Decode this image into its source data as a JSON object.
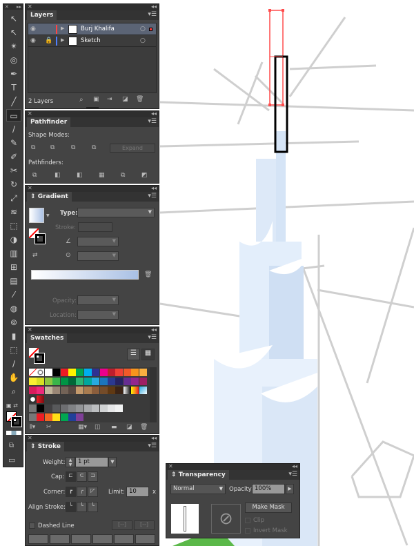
{
  "toolbar": {
    "tools": [
      "selection-tool",
      "direct-selection-tool",
      "magic-wand-tool",
      "lasso-tool",
      "pen-tool",
      "type-tool",
      "line-tool",
      "rectangle-tool",
      "paintbrush-tool",
      "pencil-tool",
      "blob-brush-tool",
      "scissors-tool",
      "rotate-tool",
      "scale-tool",
      "warp-tool",
      "free-transform-tool",
      "shape-builder-tool",
      "perspective-grid-tool",
      "mesh-tool",
      "gradient-tool",
      "eyedropper-tool",
      "blend-tool",
      "symbol-sprayer-tool",
      "column-graph-tool",
      "artboard-tool",
      "slice-tool",
      "hand-tool",
      "zoom-tool"
    ],
    "selected": "rectangle-tool"
  },
  "layers": {
    "tab": "Layers",
    "rows": [
      {
        "name": "Burj Khalifa",
        "color": "#ff4444",
        "selected": true,
        "locked": false
      },
      {
        "name": "Sketch",
        "color": "#4f7fff",
        "selected": false,
        "locked": true
      }
    ],
    "count": "2 Layers"
  },
  "pathfinder": {
    "tab": "Pathfinder",
    "shape_modes": "Shape Modes:",
    "expand": "Expand",
    "pathfinders": "Pathfinders:"
  },
  "gradient": {
    "tab": "Gradient",
    "type": "Type:",
    "stroke": "Stroke:",
    "opacity": "Opacity:",
    "location": "Location:",
    "colors": [
      "#ffffff",
      "#a9c0e4"
    ]
  },
  "swatches": {
    "tab": "Swatches",
    "rows": [
      [
        "none",
        "reg",
        "#ffffff",
        "#000000",
        "#ed1c24",
        "#fff200",
        "#00a651",
        "#00aeef",
        "#2e3192",
        "#ec008c",
        "#be1e2d",
        "#ef4136",
        "#f15a29",
        "#f7941d",
        "#fbb040"
      ],
      [
        "#f9ed32",
        "#d7df23",
        "#8dc63f",
        "#39b54a",
        "#009444",
        "#006838",
        "#2bb673",
        "#00a79d",
        "#27aae1",
        "#1c75bc",
        "#2b3990",
        "#262262",
        "#662d91",
        "#92278f",
        "#9e1f63"
      ],
      [
        "#da1c5c",
        "#ee2a7b",
        "#c2b59b",
        "#998675",
        "#736357",
        "#594a42",
        "#c49a6c",
        "#a97c50",
        "#8b5e3c",
        "#754c29",
        "#603913",
        "#3c2415",
        "grad-bw",
        "grad-orange",
        "grad-blue"
      ],
      [
        "pattern",
        "grad-red"
      ],
      [
        "folder",
        "#000000",
        "#414042",
        "#58595b",
        "#6d6e71",
        "#808285",
        "#939598",
        "#a7a9ac",
        "#bcbec0",
        "#d1d3d4",
        "#e6e7e8",
        "#f1f2f2"
      ],
      [
        "folder",
        "#ed1c24",
        "#f26522",
        "#ffde17",
        "#00a651",
        "#21409a",
        "#7f3f98"
      ]
    ]
  },
  "stroke": {
    "tab": "Stroke",
    "weight_label": "Weight:",
    "weight": "1 pt",
    "cap": "Cap:",
    "corner": "Corner:",
    "limit_label": "Limit:",
    "limit": "10",
    "limit_unit": "x",
    "align": "Align Stroke:",
    "dashed": "Dashed Line"
  },
  "transparency": {
    "tab": "Transparency",
    "blend_mode": "Normal",
    "opacity_label": "Opacity:",
    "opacity": "100%",
    "make_mask": "Make Mask",
    "clip": "Clip",
    "invert_mask": "Invert Mask"
  }
}
